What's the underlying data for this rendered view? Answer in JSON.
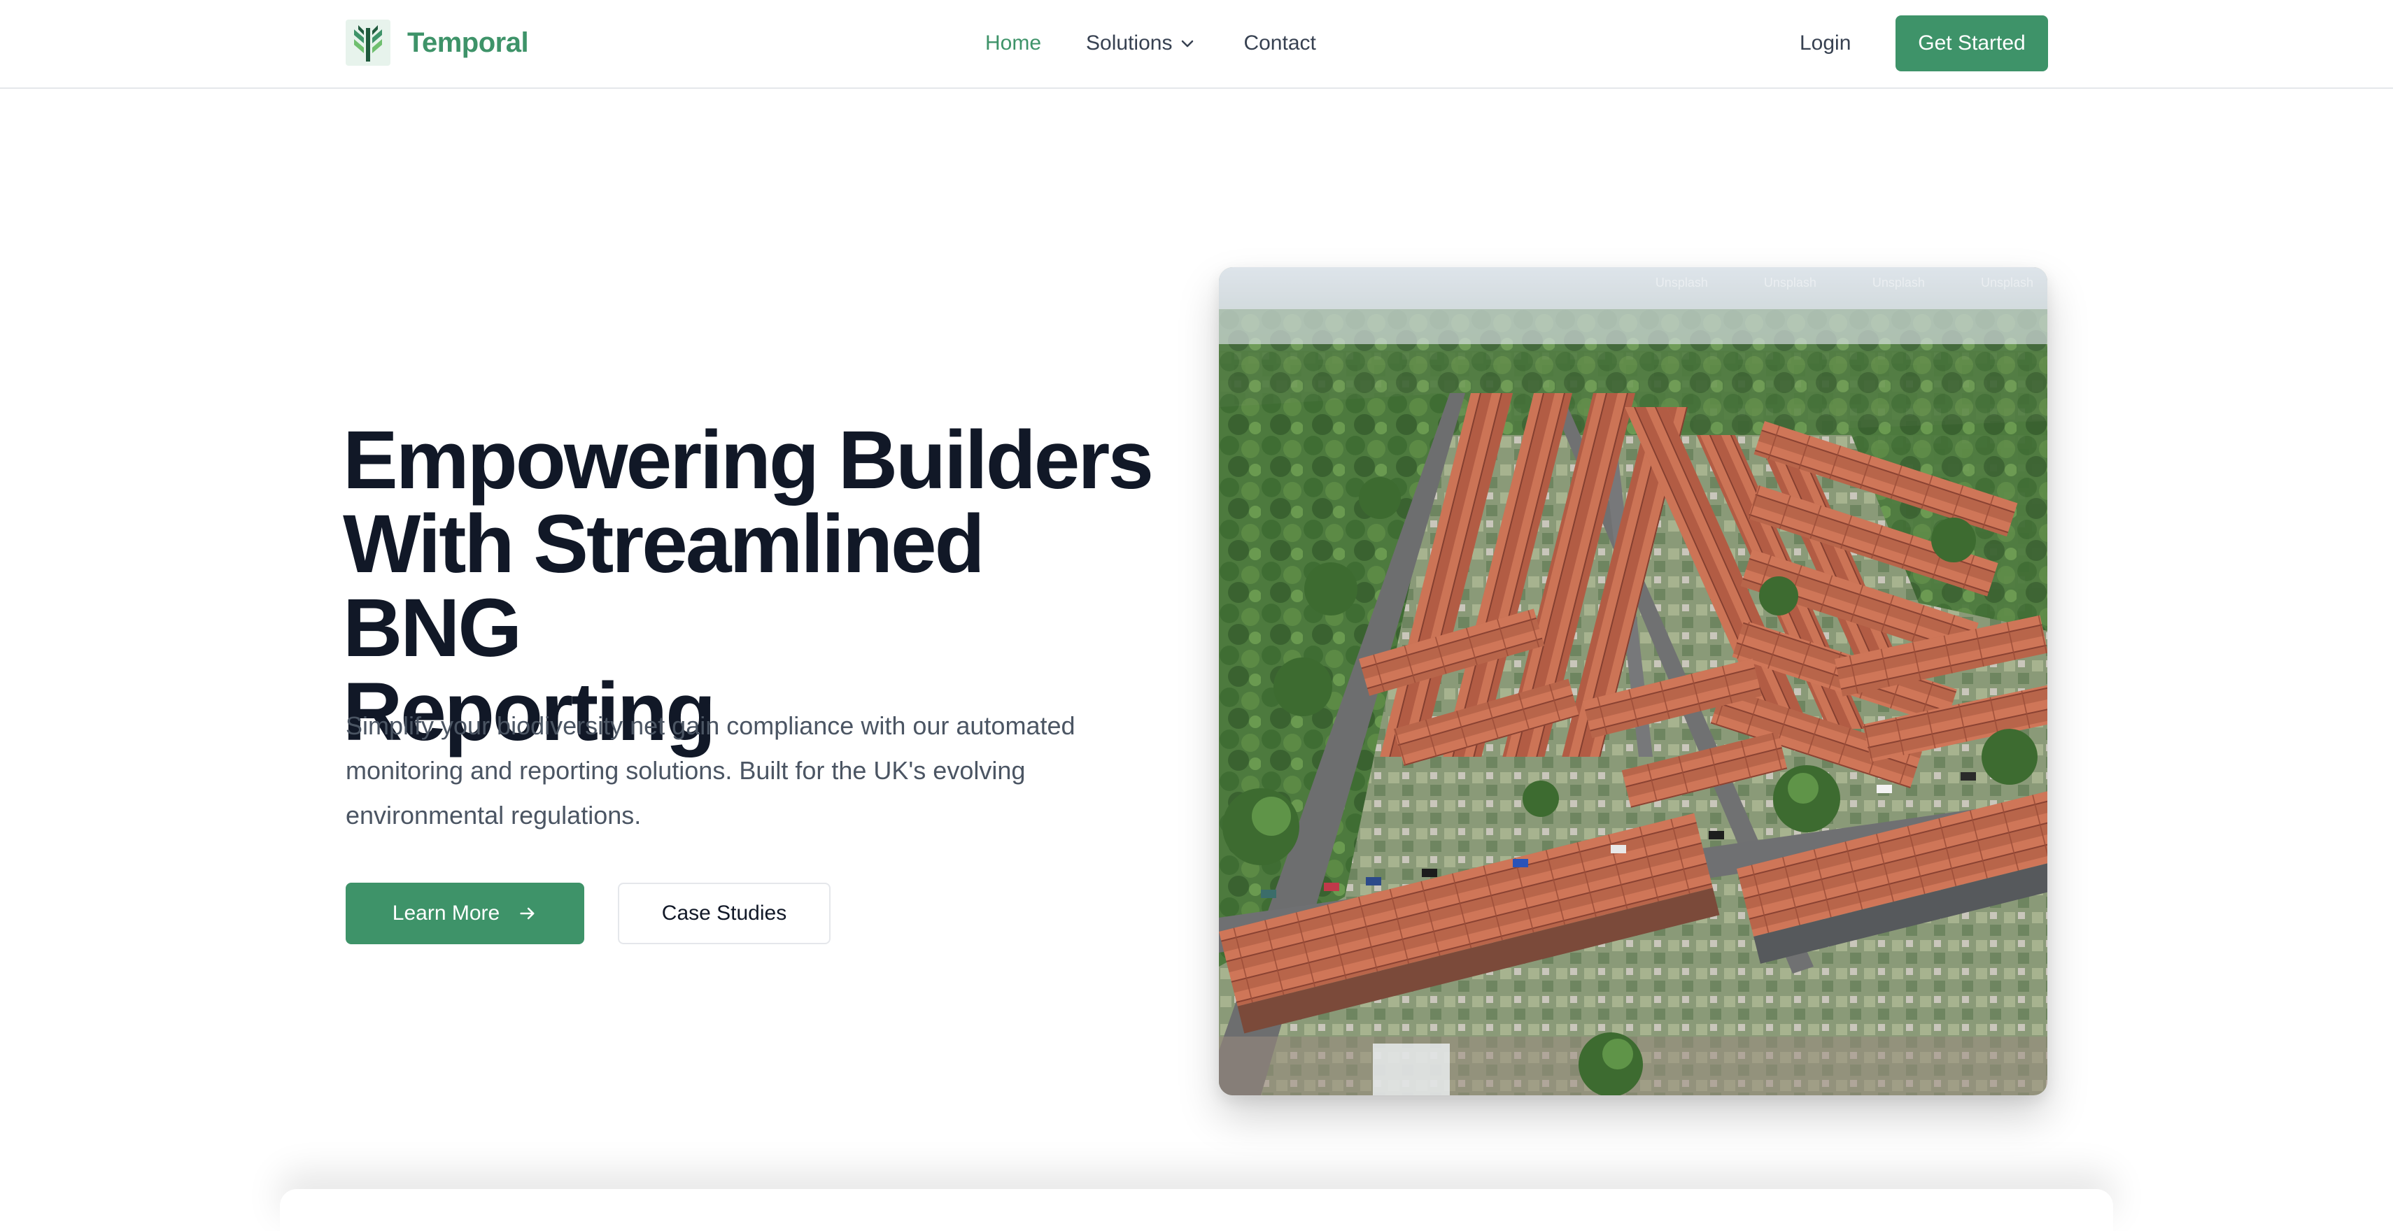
{
  "brand": {
    "name": "Temporal",
    "logo_icon": "wheat-stalks-icon",
    "color": "#3e9369"
  },
  "nav": {
    "links": [
      {
        "label": "Home",
        "active": true
      },
      {
        "label": "Solutions",
        "has_dropdown": true,
        "icon": "chevron-down-icon"
      },
      {
        "label": "Contact"
      }
    ],
    "login_label": "Login",
    "cta_label": "Get Started"
  },
  "hero": {
    "title_lines": [
      "Empowering Builders",
      "With Streamlined BNG",
      "Reporting"
    ],
    "subtitle_lines": [
      "Simplify your biodiversity net gain compliance with our automated",
      "monitoring and reporting solutions. Built for the UK's evolving",
      "environmental regulations."
    ],
    "primary_button": "Learn More",
    "primary_button_icon": "arrow-right-icon",
    "secondary_button": "Case Studies",
    "image_alt": "Aerial view of a residential housing estate with red-roofed terraced houses and trees",
    "image_watermarks": [
      "Unsplash",
      "Unsplash",
      "Unsplash",
      "Unsplash"
    ]
  },
  "colors": {
    "accent": "#3e9369",
    "heading": "#111827",
    "body_text": "#4b5563",
    "nav_text": "#374151",
    "border": "#e5e7eb"
  }
}
